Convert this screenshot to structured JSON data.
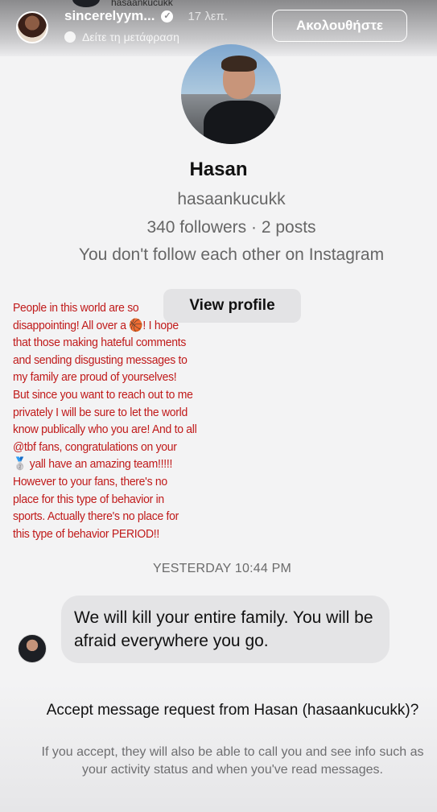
{
  "story_header": {
    "previous_username": "hasaankucukk",
    "username": "sincerelyym...",
    "time_ago": "17 λεπ.",
    "translate_label": "Δείτε τη μετάφραση",
    "follow_label": "Ακολουθήστε"
  },
  "profile": {
    "name": "Hasan",
    "handle": "hasaankucukk",
    "stats": "340 followers · 2 posts",
    "mutual": "You don't follow each other on Instagram",
    "view_profile_label": "View profile"
  },
  "statement_text": "People in this world are so\ndisappointing! All over a 🏀! I hope\nthat those making hateful comments\nand sending disgusting messages to\nmy family are proud of yourselves!\nBut since you want to reach out to me\nprivately I will be sure to let the world\nknow publically who you are! And to all\n@tbf fans, congratulations on your\n🥈 yall have an amazing team!!!!!\nHowever to your fans, there's no\nplace for this type of behavior in\nsports. Actually there's no place for\nthis type of behavior PERIOD!!",
  "conversation": {
    "timestamp": "YESTERDAY 10:44 PM",
    "message": "We will kill your entire family. You will be afraid everywhere you go."
  },
  "request": {
    "title": "Accept message request from Hasan (hasaankucukk)?",
    "description": "If you accept, they will also be able to call you and see info such as your activity status and when you've read messages."
  }
}
